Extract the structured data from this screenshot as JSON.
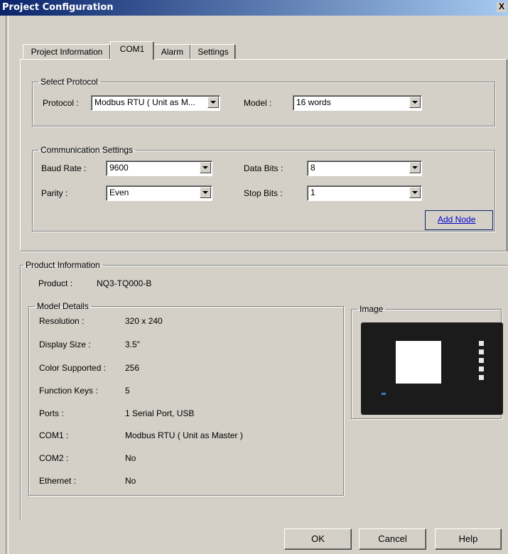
{
  "window": {
    "title": "Project Configuration",
    "close_glyph": "X"
  },
  "tabs": [
    "Project Information",
    "COM1",
    "Alarm",
    "Settings"
  ],
  "select_protocol": {
    "legend": "Select Protocol",
    "protocol_label": "Protocol :",
    "protocol_value": "Modbus RTU ( Unit as M...",
    "model_label": "Model :",
    "model_value": "16 words"
  },
  "comm": {
    "legend": "Communication Settings",
    "baud_label": "Baud Rate :",
    "baud_value": "9600",
    "parity_label": "Parity :",
    "parity_value": "Even",
    "databits_label": "Data Bits :",
    "databits_value": "8",
    "stopbits_label": "Stop Bits :",
    "stopbits_value": "1",
    "add_node": "Add Node"
  },
  "product": {
    "legend": "Product Information",
    "product_label": "Product :",
    "product_value": "NQ3-TQ000-B"
  },
  "model_details": {
    "legend": "Model Details",
    "rows": [
      {
        "label": "Resolution :",
        "value": "320 x 240"
      },
      {
        "label": "Display Size :",
        "value": "3.5\""
      },
      {
        "label": "Color Supported :",
        "value": "256"
      },
      {
        "label": "Function Keys :",
        "value": "5"
      },
      {
        "label": "Ports :",
        "value": "1 Serial Port, USB"
      },
      {
        "label": "COM1 :",
        "value": "Modbus RTU ( Unit as Master )"
      },
      {
        "label": "COM2 :",
        "value": "No"
      },
      {
        "label": "Ethernet :",
        "value": "No"
      }
    ]
  },
  "image_box": {
    "legend": "Image"
  },
  "buttons": {
    "ok": "OK",
    "cancel": "Cancel",
    "help": "Help"
  }
}
